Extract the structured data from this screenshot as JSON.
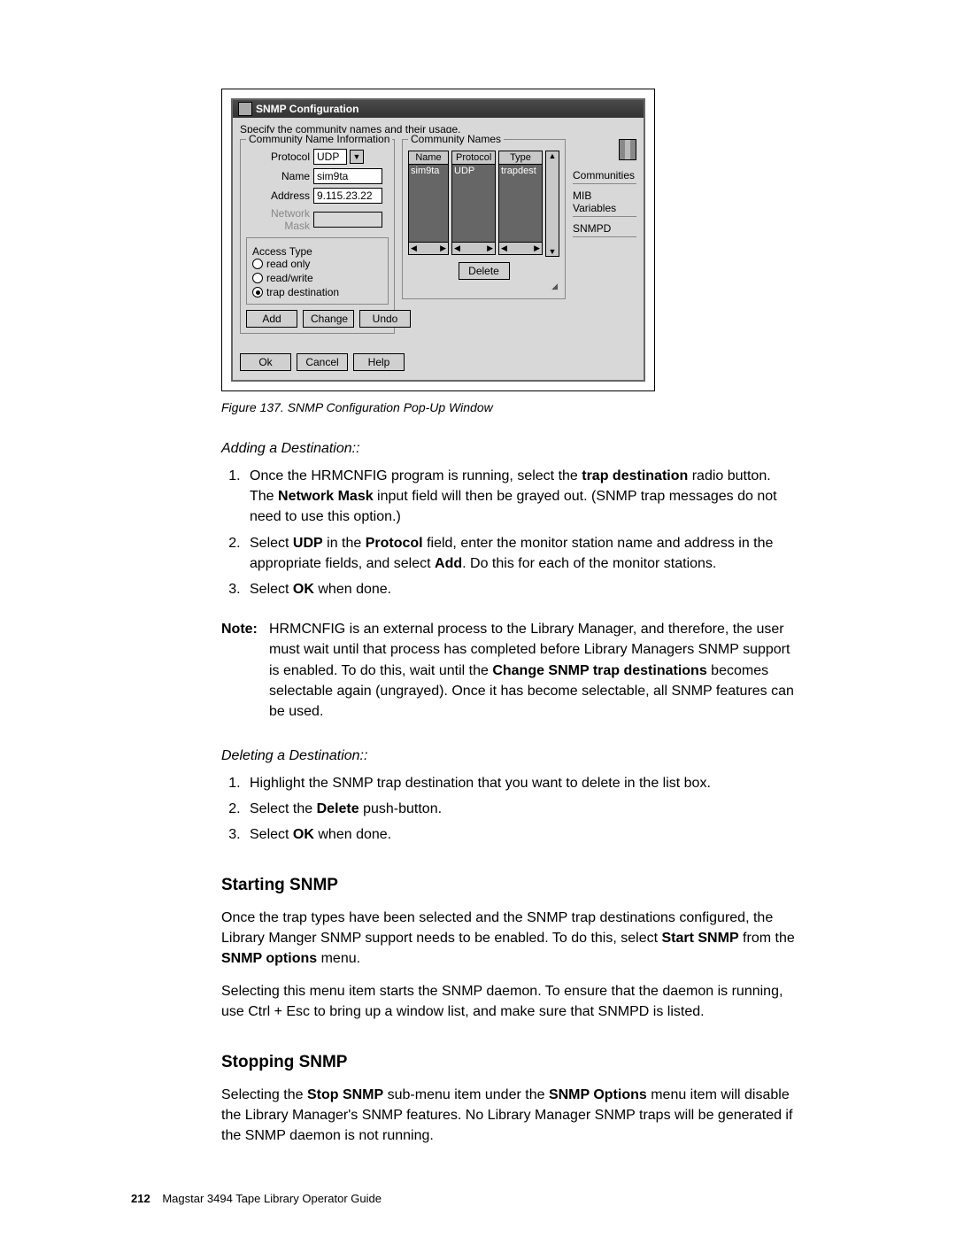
{
  "dialog": {
    "title": "SNMP Configuration",
    "instruction": "Specify the community names and their usage.",
    "cni_group_title": "Community Name Information",
    "protocol_label": "Protocol",
    "protocol_value": "UDP",
    "name_label": "Name",
    "name_value": "sim9ta",
    "address_label": "Address",
    "address_value": "9.115.23.22",
    "netmask_label": "Network Mask",
    "access_group_title": "Access Type",
    "radio_ro": "read only",
    "radio_rw": "read/write",
    "radio_td": "trap destination",
    "btn_add": "Add",
    "btn_change": "Change",
    "btn_undo": "Undo",
    "cn_group_title": "Community Names",
    "col_name": "Name",
    "col_protocol": "Protocol",
    "col_type": "Type",
    "row_name": "sim9ta",
    "row_protocol": "UDP",
    "row_type": "trapdest",
    "btn_delete": "Delete",
    "side_comm": "Communities",
    "side_mib": "MIB Variables",
    "side_snmpd": "SNMPD",
    "btn_ok": "Ok",
    "btn_cancel": "Cancel",
    "btn_help": "Help"
  },
  "caption": "Figure 137. SNMP Configuration Pop-Up Window",
  "add_dest_title": "Adding a Destination::",
  "add_steps": {
    "s1a": "Once the HRMCNFIG program is running, select the ",
    "s1b": "trap destination",
    "s1c": " radio button. The ",
    "s1d": "Network Mask",
    "s1e": " input field will then be grayed out. (SNMP trap messages do not need to use this option.)",
    "s2a": "Select ",
    "s2b": "UDP",
    "s2c": " in the ",
    "s2d": "Protocol",
    "s2e": " field, enter the monitor station name and address in the appropriate fields, and select ",
    "s2f": "Add",
    "s2g": ". Do this for each of the monitor stations.",
    "s3a": "Select ",
    "s3b": "OK",
    "s3c": " when done."
  },
  "note_label": "Note:",
  "note_a": "HRMCNFIG is an external process to the Library Manager, and therefore, the user must wait until that process has completed before Library Managers SNMP support is enabled. To do this, wait until the ",
  "note_b": "Change SNMP trap destinations",
  "note_c": " becomes selectable again (ungrayed). Once it has become selectable, all SNMP features can be used.",
  "del_dest_title": "Deleting a Destination::",
  "del_steps": {
    "d1": "Highlight the SNMP trap destination that you want to delete in the list box.",
    "d2a": "Select the ",
    "d2b": "Delete",
    "d2c": " push-button.",
    "d3a": "Select ",
    "d3b": "OK",
    "d3c": " when done."
  },
  "start_h": "Starting SNMP",
  "start_p1a": "Once the trap types have been selected and the SNMP trap destinations configured, the Library Manger SNMP support needs to be enabled. To do this, select ",
  "start_p1b": "Start SNMP",
  "start_p1c": " from the ",
  "start_p1d": "SNMP options",
  "start_p1e": " menu.",
  "start_p2": "Selecting this menu item starts the SNMP daemon. To ensure that the daemon is running, use Ctrl + Esc to bring up a window list, and make sure that SNMPD is listed.",
  "stop_h": "Stopping SNMP",
  "stop_p1a": "Selecting the ",
  "stop_p1b": "Stop SNMP",
  "stop_p1c": " sub-menu item under the ",
  "stop_p1d": "SNMP Options",
  "stop_p1e": " menu item will disable the Library Manager's SNMP features. No Library Manager SNMP traps will be generated if the SNMP daemon is not running.",
  "footer_page": "212",
  "footer_text": "Magstar 3494 Tape Library Operator Guide"
}
